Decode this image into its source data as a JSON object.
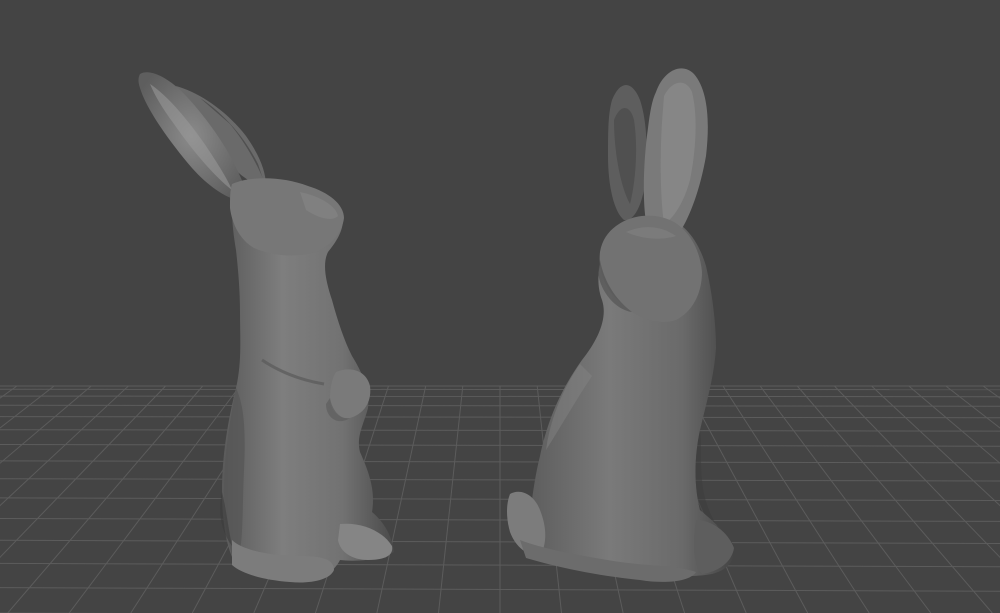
{
  "viewport": {
    "background_color": "#444444",
    "grid_color": "#5c5c5c",
    "model_colors": {
      "highlight": "#8c8c8c",
      "base": "#6f6f6f",
      "shade": "#4e4e4e",
      "deep_shadow": "#2e2e2e"
    }
  },
  "scene": {
    "objects": [
      {
        "name": "bunny-mesh-left",
        "kind": "rabbit figurine, upright, head tilted up"
      },
      {
        "name": "bunny-mesh-right",
        "kind": "rabbit figurine, seated, ears up"
      }
    ]
  }
}
